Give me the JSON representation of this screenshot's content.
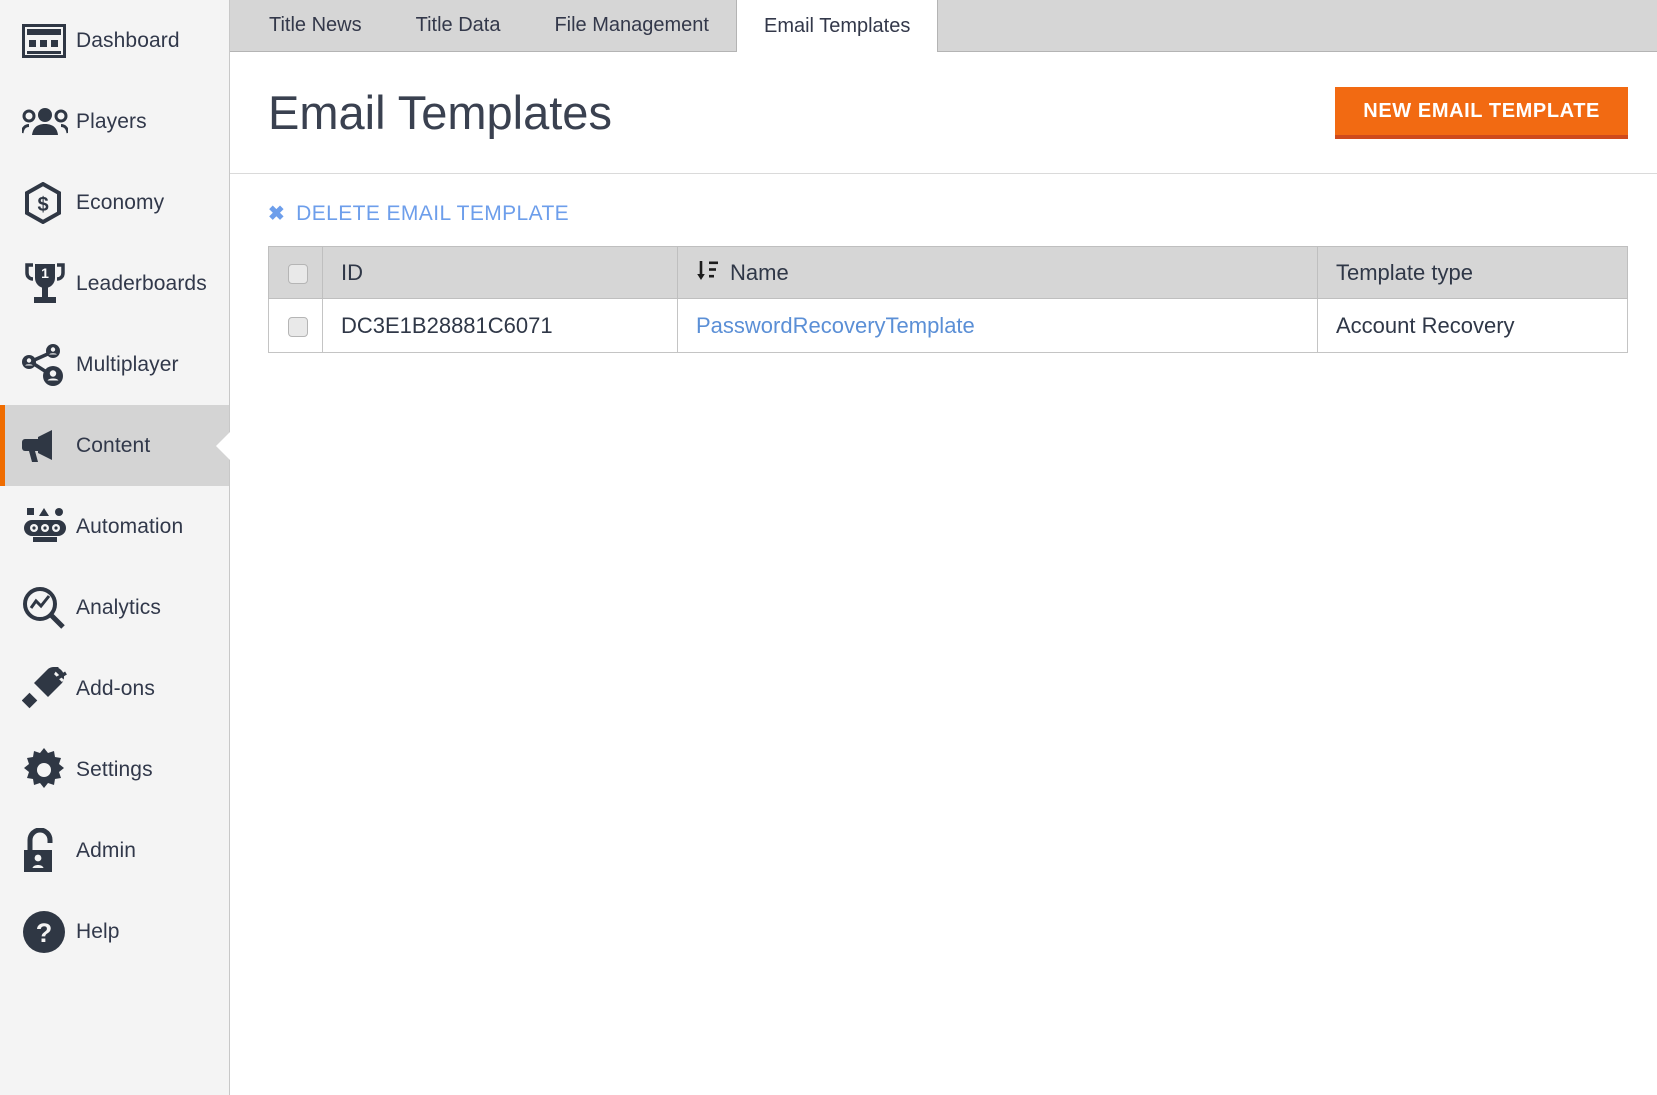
{
  "sidebar": {
    "items": [
      {
        "label": "Dashboard",
        "icon": "dashboard-icon",
        "active": false
      },
      {
        "label": "Players",
        "icon": "players-icon",
        "active": false
      },
      {
        "label": "Economy",
        "icon": "economy-icon",
        "active": false
      },
      {
        "label": "Leaderboards",
        "icon": "leaderboards-icon",
        "active": false
      },
      {
        "label": "Multiplayer",
        "icon": "multiplayer-icon",
        "active": false
      },
      {
        "label": "Content",
        "icon": "content-icon",
        "active": true
      },
      {
        "label": "Automation",
        "icon": "automation-icon",
        "active": false
      },
      {
        "label": "Analytics",
        "icon": "analytics-icon",
        "active": false
      },
      {
        "label": "Add-ons",
        "icon": "addons-icon",
        "active": false
      },
      {
        "label": "Settings",
        "icon": "settings-icon",
        "active": false
      },
      {
        "label": "Admin",
        "icon": "admin-icon",
        "active": false
      },
      {
        "label": "Help",
        "icon": "help-icon",
        "active": false
      }
    ]
  },
  "tabs": [
    {
      "label": "Title News",
      "active": false
    },
    {
      "label": "Title Data",
      "active": false
    },
    {
      "label": "File Management",
      "active": false
    },
    {
      "label": "Email Templates",
      "active": true
    }
  ],
  "header": {
    "title": "Email Templates",
    "new_button_label": "NEW EMAIL TEMPLATE"
  },
  "actions": {
    "delete_label": "DELETE EMAIL TEMPLATE",
    "delete_icon": "close-x-icon"
  },
  "table": {
    "sort_icon": "sort-amount-down-icon",
    "columns": [
      {
        "key": "check",
        "label": ""
      },
      {
        "key": "id",
        "label": "ID"
      },
      {
        "key": "name",
        "label": "Name",
        "sorted": true
      },
      {
        "key": "type",
        "label": "Template type"
      }
    ],
    "rows": [
      {
        "checked": false,
        "id": "DC3E1B28881C6071",
        "name": "PasswordRecoveryTemplate",
        "type": "Account Recovery"
      }
    ]
  },
  "colors": {
    "accent_orange": "#f26a12",
    "accent_orange_shadow": "#cf4a1c",
    "link_blue": "#5b8fd6",
    "delete_blue": "#6d9eeb",
    "sidebar_bg": "#f4f4f4",
    "sidebar_active_bg": "#d4d4d4",
    "tab_bg": "#d6d6d6",
    "text_dark": "#2f3747"
  }
}
